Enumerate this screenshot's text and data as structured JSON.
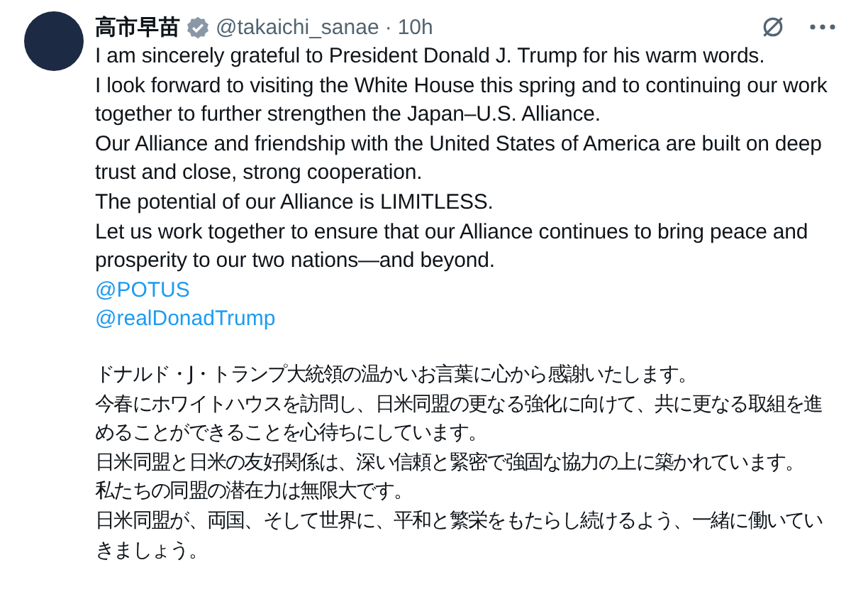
{
  "post": {
    "author_name": "高市早苗",
    "verified": true,
    "handle": "@takaichi_sanae",
    "separator": "·",
    "time": "10h",
    "english_paragraphs": [
      "I am sincerely grateful to President Donald J. Trump for his warm words.",
      "I look forward to visiting the White House this spring and to continuing our work together to further strengthen the Japan–U.S. Alliance.",
      "Our Alliance and friendship with the United States of America are built on deep trust and close, strong cooperation.",
      "The potential of our Alliance is LIMITLESS.",
      "Let us work together to ensure that our Alliance continues to bring peace and prosperity to our two nations—and beyond."
    ],
    "mentions": [
      "@POTUS",
      "@realDonadTrump"
    ],
    "japanese_paragraphs": [
      "ドナルド・J・トランプ大統領の温かいお言葉に心から感謝いたします。",
      "今春にホワイトハウスを訪問し、日米同盟の更なる強化に向けて、共に更なる取組を進めることができることを心待ちにしています。",
      "日米同盟と日米の友好関係は、深い信頼と緊密で強固な協力の上に築かれています。",
      "私たちの同盟の潜在力は無限大です。",
      "日米同盟が、両国、そして世界に、平和と繁栄をもたらし続けるよう、一緒に働いていきましょう。"
    ]
  }
}
